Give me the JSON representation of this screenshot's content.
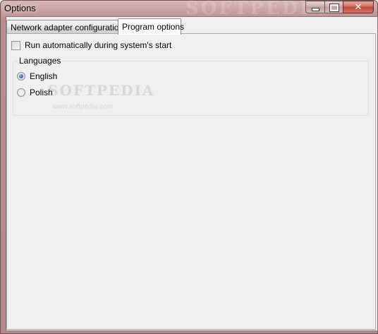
{
  "window": {
    "title": "Options",
    "title_watermark": "SOFTPEDIA",
    "controls": {
      "close_glyph": "✕"
    }
  },
  "tabs": [
    {
      "label": "Network adapter configurations",
      "active": false
    },
    {
      "label": "Program options",
      "active": true
    }
  ],
  "program_options": {
    "autostart": {
      "label": "Run automatically during system's start",
      "checked": false
    },
    "languages": {
      "legend": "Languages",
      "options": [
        {
          "label": "English",
          "selected": true
        },
        {
          "label": "Polish",
          "selected": false
        }
      ]
    }
  },
  "watermark": {
    "big": "SOFTPEDIA",
    "small": "www.softpedia.com"
  },
  "colors": {
    "title_bar": "#c9a2a2",
    "client_bg": "#f0f0f0",
    "close_button": "#c1453c",
    "radio_selected": "#2a6cc2"
  },
  "icons": [
    "minimize-icon",
    "maximize-icon",
    "close-icon"
  ]
}
